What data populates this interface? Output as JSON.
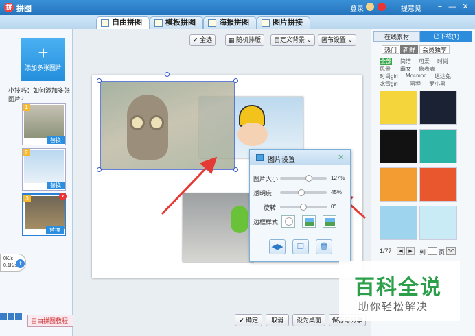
{
  "titlebar": {
    "title": "拼图",
    "login": "登录",
    "feedback": "提意见"
  },
  "tabs": [
    {
      "label": "自由拼图",
      "active": true
    },
    {
      "label": "模板拼图"
    },
    {
      "label": "海报拼图"
    },
    {
      "label": "图片拼接"
    }
  ],
  "left": {
    "add_label": "添加多张图片",
    "add_symbol": "+",
    "tip": "小技巧：如何添加多张图片？",
    "thumbs": [
      {
        "num": "1",
        "replace": "替换"
      },
      {
        "num": "2",
        "replace": "替换"
      },
      {
        "num": "3",
        "replace": "替换",
        "delete": "×"
      }
    ],
    "speed_down": "0K/s",
    "speed_up": "0.1K/s",
    "tutorial": "自由拼图教程"
  },
  "toolbar": {
    "select_all": "全选",
    "random_layout": "随机排版",
    "custom_bg": "自定义背景",
    "canvas_settings": "画布设置"
  },
  "popup": {
    "title": "图片设置",
    "close": "✕",
    "size_label": "图片大小",
    "size_value": "127%",
    "size_fraction": 0.64,
    "opacity_label": "透明度",
    "opacity_value": "45%",
    "opacity_fraction": 0.45,
    "rotate_label": "旋转",
    "rotate_value": "0°",
    "rotate_fraction": 0.5,
    "frame_label": "边框样式"
  },
  "right": {
    "tab_online": "在线素材",
    "tab_downloaded": "已下载(1)",
    "categories": [
      "热门",
      "新鲜",
      "会员独享"
    ],
    "tags": [
      "全部",
      "简洁",
      "可爱",
      "时尚",
      "风景",
      "霸女",
      "修表表",
      "时尚girl",
      "Mocmoc",
      "达达兔",
      "冰雪girl",
      "阿狸",
      "罗小黑"
    ],
    "page_text": "1/77",
    "goto": "到",
    "page_unit": "页",
    "go": "GO"
  },
  "bottom": {
    "confirm": "确定",
    "cancel": "取消",
    "set_desktop": "设为桌面",
    "save_share": "保存与分享"
  },
  "watermark": {
    "title": "百科全说",
    "subtitle": "助你轻松解决"
  },
  "colors": {
    "accent": "#2d8ddc",
    "selection": "#3355cc",
    "arrow": "#e53935",
    "watermark": "#2b9f4a"
  }
}
